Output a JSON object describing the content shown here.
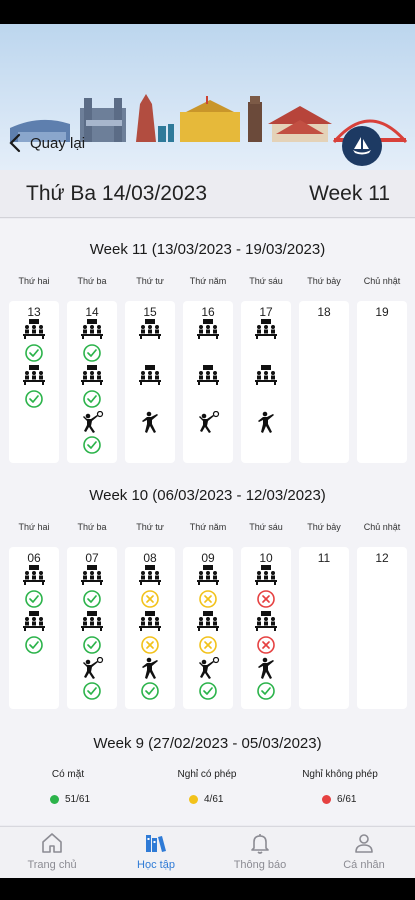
{
  "colors": {
    "present": "#2bb34a",
    "excused": "#f2c21b",
    "unexcused": "#e64141",
    "accent": "#2f7bd6",
    "logo_bg": "#1d3a63"
  },
  "header": {
    "back_label": "Quay lại"
  },
  "datebar": {
    "date": "Thứ Ba 14/03/2023",
    "week": "Week 11"
  },
  "day_names": [
    "Thứ hai",
    "Thứ ba",
    "Thứ tư",
    "Thứ năm",
    "Thứ sáu",
    "Thứ bảy",
    "Chủ nhật"
  ],
  "weeks": [
    {
      "title": "Week 11 (13/03/2023 - 19/03/2023)",
      "days": [
        {
          "num": "13",
          "items": [
            "class-icon",
            "present",
            "class-icon",
            "present"
          ]
        },
        {
          "num": "14",
          "items": [
            "class-icon",
            "present",
            "class-icon",
            "present",
            "volleyball-icon",
            "present"
          ]
        },
        {
          "num": "15",
          "items": [
            "class-icon",
            "",
            "class-icon",
            "",
            "martial-arts-icon",
            ""
          ]
        },
        {
          "num": "16",
          "items": [
            "class-icon",
            "",
            "class-icon",
            "",
            "volleyball-icon",
            ""
          ]
        },
        {
          "num": "17",
          "items": [
            "class-icon",
            "",
            "class-icon",
            "",
            "martial-arts-icon",
            ""
          ]
        },
        {
          "num": "18",
          "items": []
        },
        {
          "num": "19",
          "items": []
        }
      ]
    },
    {
      "title": "Week 10 (06/03/2023 - 12/03/2023)",
      "days": [
        {
          "num": "06",
          "items": [
            "class-icon",
            "present",
            "class-icon",
            "present"
          ]
        },
        {
          "num": "07",
          "items": [
            "class-icon",
            "present",
            "class-icon",
            "present",
            "volleyball-icon",
            "present"
          ]
        },
        {
          "num": "08",
          "items": [
            "class-icon",
            "excused",
            "class-icon",
            "excused",
            "martial-arts-icon",
            "present"
          ]
        },
        {
          "num": "09",
          "items": [
            "class-icon",
            "excused",
            "class-icon",
            "excused",
            "volleyball-icon",
            "present"
          ]
        },
        {
          "num": "10",
          "items": [
            "class-icon",
            "unexcused",
            "class-icon",
            "unexcused",
            "martial-arts-icon",
            "present"
          ]
        },
        {
          "num": "11",
          "items": []
        },
        {
          "num": "12",
          "items": []
        }
      ]
    },
    {
      "title": "Week 9 (27/02/2023 - 05/03/2023)"
    }
  ],
  "legend": [
    {
      "label": "Có mặt",
      "value": "51/61",
      "status": "present"
    },
    {
      "label": "Nghỉ có phép",
      "value": "4/61",
      "status": "excused"
    },
    {
      "label": "Nghỉ không phép",
      "value": "6/61",
      "status": "unexcused"
    }
  ],
  "tabs": [
    {
      "label": "Trang chủ",
      "icon": "home-icon",
      "active": false
    },
    {
      "label": "Học tập",
      "icon": "books-icon",
      "active": true
    },
    {
      "label": "Thông báo",
      "icon": "bell-icon",
      "active": false
    },
    {
      "label": "Cá nhân",
      "icon": "person-icon",
      "active": false
    }
  ]
}
